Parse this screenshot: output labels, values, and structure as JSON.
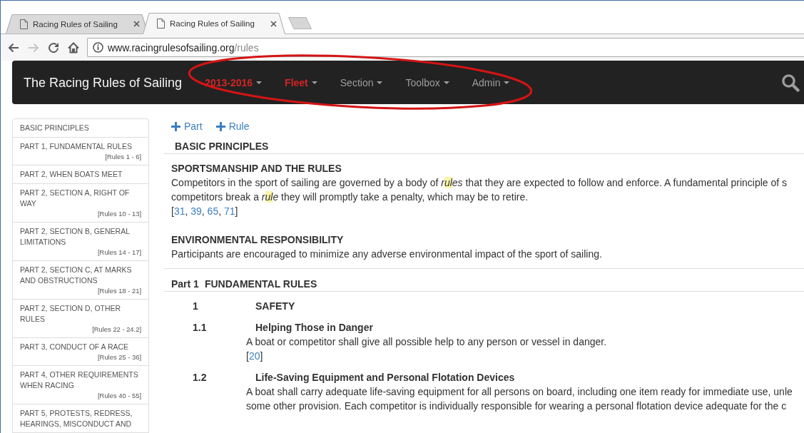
{
  "browser": {
    "tabs": [
      {
        "title": "Racing Rules of Sailing",
        "selected": false
      },
      {
        "title": "Racing Rules of Sailing",
        "selected": true
      }
    ],
    "nav_buttons": [
      {
        "kind": "back",
        "disabled": false
      },
      {
        "kind": "forward",
        "disabled": true
      },
      {
        "kind": "reload",
        "disabled": false
      },
      {
        "kind": "home",
        "disabled": false
      }
    ],
    "address_bar": {
      "host": "www.racingrulesofsailing.org",
      "path": "/rules"
    }
  },
  "navbar": {
    "brand": "The Racing Rules of Sailing",
    "menus": [
      {
        "label": "2013-2016",
        "active": true
      },
      {
        "label": "Fleet",
        "active": true
      },
      {
        "label": "Section",
        "active": false
      },
      {
        "label": "Toolbox",
        "active": false
      },
      {
        "label": "Admin",
        "active": false
      }
    ]
  },
  "sidebar": {
    "items": [
      {
        "label": "BASIC PRINCIPLES"
      },
      {
        "label": "PART 1, FUNDAMENTAL RULES",
        "range": "[Rules 1 - 6]"
      },
      {
        "label": "PART 2, WHEN BOATS MEET"
      },
      {
        "label": "PART 2, SECTION A, RIGHT OF WAY",
        "range": "[Rules 10 - 13]"
      },
      {
        "label": "PART 2, SECTION B, GENERAL LIMITATIONS",
        "range": "[Rules 14 - 17]"
      },
      {
        "label": "PART 2, SECTION C, AT MARKS AND OBSTRUCTIONS",
        "range": "[Rules 18 - 21]"
      },
      {
        "label": "PART 2, SECTION D, OTHER RULES",
        "range": "[Rules 22 - 24.2]"
      },
      {
        "label": "PART 3, CONDUCT OF A RACE",
        "range": "[Rules 25 - 36]"
      },
      {
        "label": "PART 4, OTHER REQUIREMENTS WHEN RACING",
        "range": "[Rules 40 - 55]"
      },
      {
        "label": "PART 5, PROTESTS, REDRESS, HEARINGS, MISCONDUCT AND"
      }
    ]
  },
  "content": {
    "actions": [
      {
        "label": "Part"
      },
      {
        "label": "Rule"
      }
    ],
    "basic_principles": {
      "title": "BASIC PRINCIPLES",
      "articles": [
        {
          "title": "SPORTSMANSHIP AND THE RULES",
          "lines": [
            [
              {
                "kind": "plain",
                "text": "Competitors in the sport of sailing are governed by a body of *r*"
              },
              {
                "kind": "highlight",
                "text": "*ul*"
              },
              {
                "kind": "plain",
                "text": "*es* that they are expected to follow and enforce. A fundamental principle of s"
              }
            ],
            [
              {
                "kind": "plain",
                "text": "competitors break a *r*"
              },
              {
                "kind": "highlight",
                "text": "*ul*"
              },
              {
                "kind": "plain",
                "text": "*e* they will promptly take a penalty, which may be to retire."
              }
            ]
          ],
          "references": [
            {
              "kind": "plain",
              "text": "["
            },
            {
              "kind": "link",
              "text": "31"
            },
            {
              "kind": "plain",
              "text": ", "
            },
            {
              "kind": "link",
              "text": "39"
            },
            {
              "kind": "plain",
              "text": ", "
            },
            {
              "kind": "link",
              "text": "65"
            },
            {
              "kind": "plain",
              "text": ", "
            },
            {
              "kind": "link",
              "text": "71"
            },
            {
              "kind": "plain",
              "text": "]"
            }
          ]
        },
        {
          "title": "ENVIRONMENTAL RESPONSIBILITY",
          "lines": [
            [
              {
                "kind": "plain",
                "text": "Participants are encouraged to minimize any adverse environmental impact of the sport of sailing."
              }
            ]
          ]
        }
      ]
    },
    "part": {
      "number": "Part 1",
      "title": "FUNDAMENTAL RULES",
      "rules": [
        {
          "number": "1",
          "title": "SAFETY"
        },
        {
          "number": "1.1",
          "title": "Helping Those in Danger",
          "lines": [
            [
              {
                "kind": "plain",
                "text": "A boat or competitor shall give all possible help to any person or vessel in danger."
              }
            ]
          ],
          "references": [
            {
              "kind": "plain",
              "text": "["
            },
            {
              "kind": "link",
              "text": "20"
            },
            {
              "kind": "plain",
              "text": "]"
            }
          ]
        },
        {
          "number": "1.2",
          "title": "Life-Saving Equipment and Personal Flotation Devices",
          "lines": [
            [
              {
                "kind": "plain",
                "text": "A boat shall carry adequate life-saving equipment for all persons on board, including one item ready for immediate use, unle"
              }
            ],
            [
              {
                "kind": "plain",
                "text": "some other provision. Each competitor is individually responsible for wearing a personal flotation device adequate for the c"
              }
            ]
          ]
        }
      ]
    }
  }
}
